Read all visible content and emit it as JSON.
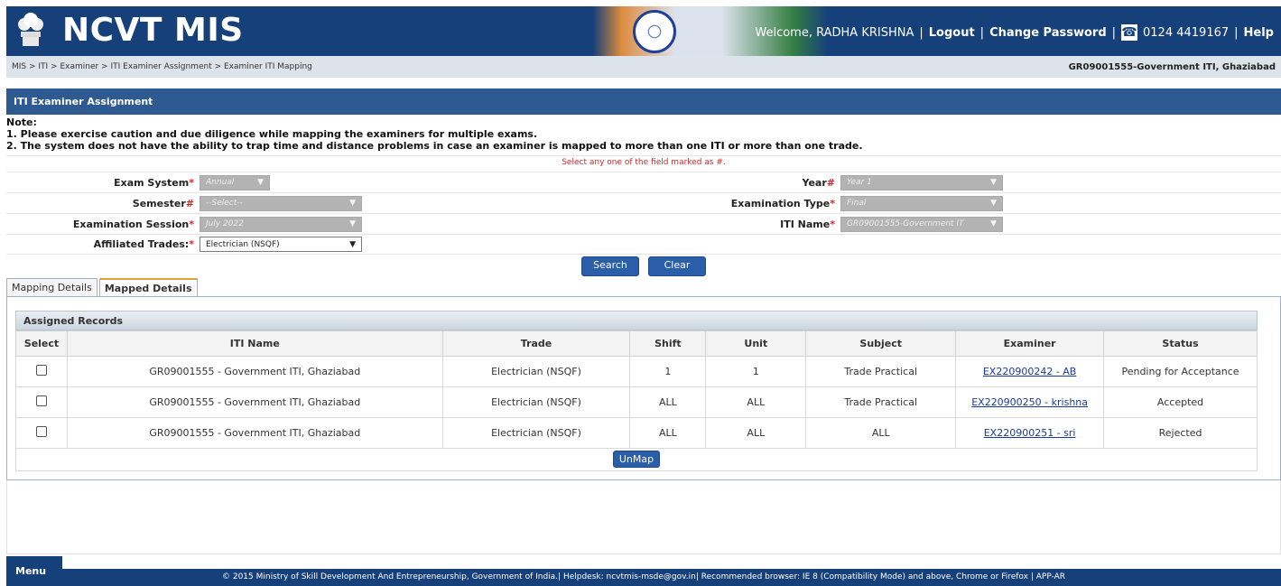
{
  "header": {
    "app_title": "NCVT MIS",
    "welcome": "Welcome, RADHA KRISHNA",
    "logout": "Logout",
    "change_password": "Change Password",
    "phone": "0124 4419167",
    "help": "Help",
    "separator": "|"
  },
  "breadcrumb": {
    "path": "MIS > ITI > Examiner > ITI Examiner Assignment > Examiner ITI Mapping",
    "iti": "GR09001555-Government ITI, Ghaziabad"
  },
  "panel": {
    "title": "ITI Examiner Assignment",
    "note_title": "Note:",
    "note_1": "1. Please exercise caution and due diligence while mapping the examiners for multiple exams.",
    "note_2": "2. The system does not have the ability to trap time and distance problems in case an examiner is mapped to more than one ITI or more than one trade.",
    "hint": "Select any one of the field marked as #."
  },
  "form": {
    "exam_system": {
      "label": "Exam System",
      "marker": "*",
      "value": "Annual"
    },
    "year": {
      "label": "Year",
      "marker": "#",
      "value": "Year 1"
    },
    "semester": {
      "label": "Semester",
      "marker": "#",
      "value": "--Select--"
    },
    "examination_type": {
      "label": "Examination Type",
      "marker": "*",
      "value": "Final"
    },
    "examination_session": {
      "label": "Examination Session",
      "marker": "*",
      "value": "July 2022"
    },
    "iti_name": {
      "label": "ITI Name",
      "marker": "*",
      "value": "GR09001555-Government IT"
    },
    "affiliated_trades": {
      "label": "Affiliated Trades:",
      "marker": "*",
      "value": "Electrician (NSQF)"
    }
  },
  "buttons": {
    "search": "Search",
    "clear": "Clear",
    "unmap": "UnMap"
  },
  "tabs": [
    {
      "label": "Mapping Details",
      "active": false
    },
    {
      "label": "Mapped Details",
      "active": true
    }
  ],
  "records": {
    "title": "Assigned Records",
    "columns": [
      "Select",
      "ITI Name",
      "Trade",
      "Shift",
      "Unit",
      "Subject",
      "Examiner",
      "Status"
    ],
    "rows": [
      {
        "iti": "GR09001555 - Government ITI, Ghaziabad",
        "trade": "Electrician (NSQF)",
        "shift": "1",
        "unit": "1",
        "subject": "Trade Practical",
        "examiner": "EX220900242 - AB",
        "status": "Pending for Acceptance"
      },
      {
        "iti": "GR09001555 - Government ITI, Ghaziabad",
        "trade": "Electrician (NSQF)",
        "shift": "ALL",
        "unit": "ALL",
        "subject": "Trade Practical",
        "examiner": "EX220900250 - krishna",
        "status": "Accepted"
      },
      {
        "iti": "GR09001555 - Government ITI, Ghaziabad",
        "trade": "Electrician (NSQF)",
        "shift": "ALL",
        "unit": "ALL",
        "subject": "ALL",
        "examiner": "EX220900251 - sri",
        "status": "Rejected"
      }
    ]
  },
  "footer": {
    "menu": "Menu",
    "text": "© 2015 Ministry of Skill Development And Entrepreneurship, Government of India.| Helpdesk: ncvtmis-msde@gov.in| Recommended browser: IE 8 (Compatibility Mode) and above, Chrome or Firefox | APP-AR"
  },
  "colors": {
    "primary": "#16407a",
    "panel": "#2e5a92",
    "required": "#cc2a2a",
    "button": "#2a5ea8"
  },
  "icons": [
    "national-emblem-icon",
    "ashoka-chakra-icon",
    "phone-icon",
    "chevron-down-icon"
  ]
}
